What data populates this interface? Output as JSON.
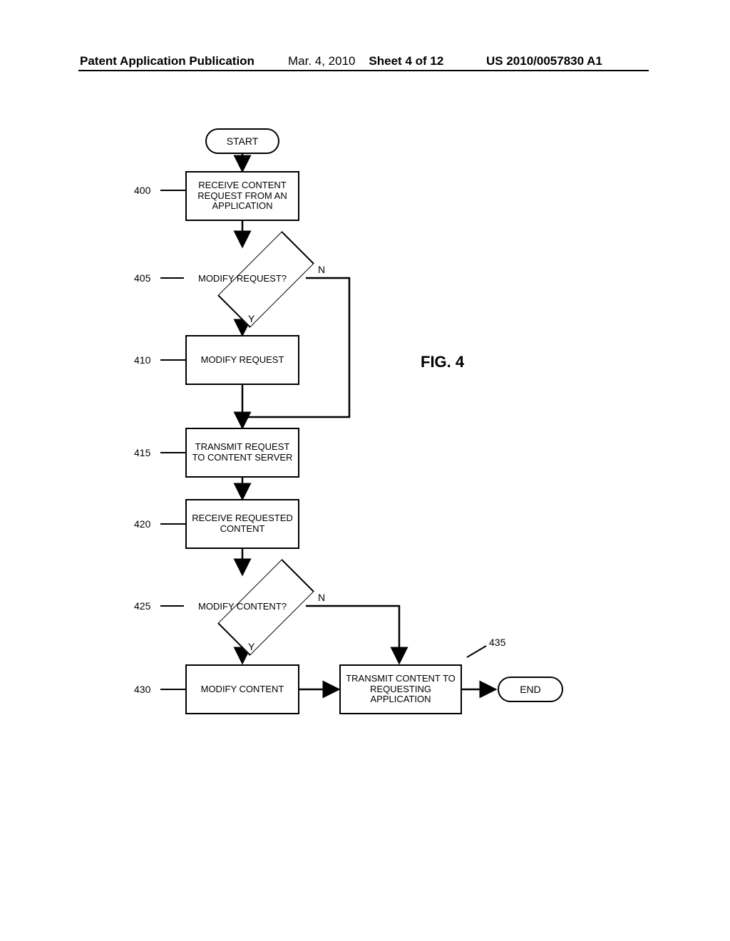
{
  "header": {
    "left": "Patent Application Publication",
    "date": "Mar. 4, 2010",
    "sheet": "Sheet 4 of 12",
    "pubnum": "US 2010/0057830 A1"
  },
  "figure_label": "FIG. 4",
  "nodes": {
    "start": "START",
    "n400": "RECEIVE CONTENT REQUEST FROM AN APPLICATION",
    "n405": "MODIFY REQUEST?",
    "n410": "MODIFY REQUEST",
    "n415": "TRANSMIT REQUEST TO CONTENT SERVER",
    "n420": "RECEIVE REQUESTED CONTENT",
    "n425": "MODIFY CONTENT?",
    "n430": "MODIFY CONTENT",
    "n435": "TRANSMIT CONTENT TO REQUESTING APPLICATION",
    "end": "END"
  },
  "refs": {
    "r400": "400",
    "r405": "405",
    "r410": "410",
    "r415": "415",
    "r420": "420",
    "r425": "425",
    "r430": "430",
    "r435": "435"
  },
  "branches": {
    "y": "Y",
    "n": "N"
  }
}
